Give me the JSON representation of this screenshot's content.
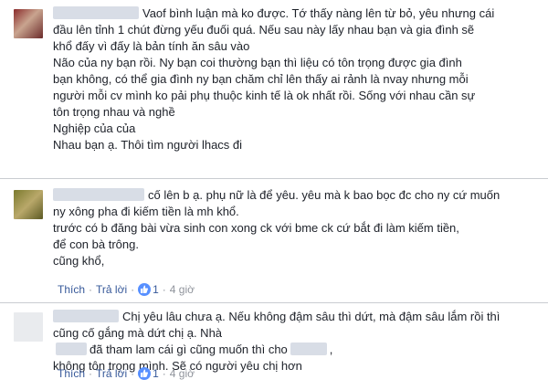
{
  "comments": [
    {
      "author_blurred": true,
      "lines": [
        "Vaof bình luận mà ko được. Tớ thấy nàng lên từ bỏ, yêu nhưng cái",
        "đầu lên tỉnh 1 chút đừng yếu đuối quá. Nếu sau này lấy nhau bạn và gia đình sẽ",
        "khổ đấy vì đấy là bản tính ăn sâu vào",
        "Não của ny bạn rồi. Ny bạn coi thường bạn thì liệu có tôn trọng được gia đình",
        "bạn không, có thể gia đình ny bạn chăm chỉ lên thấy ai rảnh là nvay nhưng mỗi",
        "người mỗi cv mình ko pải phụ thuộc kinh tế là ok nhất rồi. Sống với nhau cần sự",
        "tôn trọng nhau và nghề",
        "Nghiệp của của",
        "Nhau bạn ạ. Thôi tìm người lhacs đi"
      ]
    },
    {
      "author_blurred": true,
      "lines": [
        "cố lên b ạ. phụ nữ là để yêu. yêu mà k bao bọc đc cho ny cứ muốn",
        "ny xông pha đi kiếm tiền là mh khổ.",
        "trước có b đăng bài vừa sinh con xong ck với bme ck cứ bắt đi làm kiếm tiền,",
        "để con bà trông.",
        "cũng khổ,"
      ],
      "actions": {
        "like": "Thích",
        "reply": "Trả lời",
        "like_count": "1",
        "time": "4 giờ"
      }
    },
    {
      "author_blurred": true,
      "line1": "Chị yêu lâu chưa ạ. Nếu không đậm sâu thì dứt, mà đậm sâu lắm rồi thì",
      "line2": "cũng cố gắng mà dứt chị ạ. Nhà",
      "line3_a": "đã tham lam cái gì cũng muốn thì cho",
      "line3_b": ",",
      "line4": "không tôn trọng mình. Sẽ có người yêu chị hơn",
      "actions": {
        "like": "Thích",
        "reply": "Trả lời",
        "like_count": "1",
        "time": "4 giờ"
      }
    }
  ],
  "colors": {
    "link": "#365899",
    "meta": "#90949c",
    "like_badge": "#5890ff"
  },
  "icons": {
    "like": "thumbs-up-icon"
  }
}
